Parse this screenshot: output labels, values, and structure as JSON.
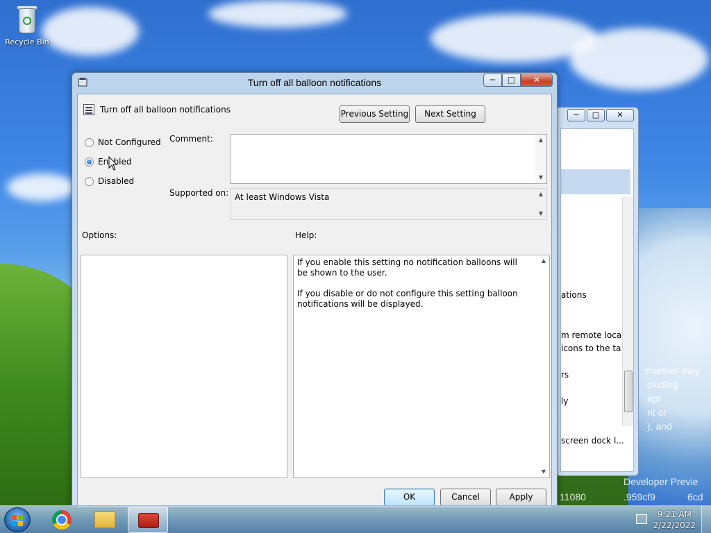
{
  "desktop": {
    "recycle_bin_label": "Recycle Bin",
    "art_lines": [
      "manner may",
      "cluding",
      "apt",
      "nt or",
      "), and",
      "Developer Previe",
      "11080",
      ".959cf9",
      "6cd"
    ]
  },
  "background_window": {
    "min": "─",
    "max": "□",
    "close": "✕",
    "lines": [
      "ations",
      "m remote loca...",
      "icons to the ta...",
      "rs",
      "ly",
      "screen dock l..."
    ]
  },
  "dialog": {
    "title": "Turn off all balloon notifications",
    "setting_name": "Turn off all balloon notifications",
    "previous_setting": "Previous Setting",
    "next_setting": "Next Setting",
    "radios": {
      "not_configured": "Not Configured",
      "enabled": "Enabled",
      "disabled": "Disabled",
      "selected": "enabled"
    },
    "comment_label": "Comment:",
    "comment_value": "",
    "supported_on_label": "Supported on:",
    "supported_on_value": "At least Windows Vista",
    "options_label": "Options:",
    "help_label": "Help:",
    "help_text_1": "If you enable this setting no notification balloons will be shown to the user.",
    "help_text_2": "If you disable or do not configure this setting balloon notifications will be displayed.",
    "ok": "OK",
    "cancel": "Cancel",
    "apply": "Apply",
    "window_buttons": {
      "min": "─",
      "max": "□",
      "close": "✕"
    }
  },
  "taskbar": {
    "time": "9:21 AM",
    "date": "2/22/2022",
    "items": [
      "start-button",
      "chrome-icon",
      "file-explorer-icon",
      "group-policy-editor-icon"
    ]
  }
}
